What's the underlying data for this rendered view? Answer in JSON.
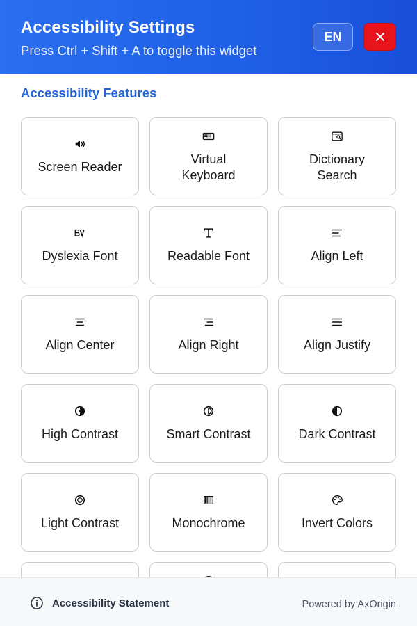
{
  "header": {
    "title": "Accessibility Settings",
    "subtitle": "Press Ctrl + Shift + A to toggle this widget",
    "language_label": "EN",
    "close_icon": "close-icon",
    "gradient_start": "#2a6fef",
    "gradient_end": "#1a4fd8",
    "close_color": "#e8141c"
  },
  "section": {
    "title": "Accessibility Features",
    "title_color": "#2566d6"
  },
  "features": [
    {
      "label": "Screen Reader",
      "icon": "speaker-icon"
    },
    {
      "label": "Virtual Keyboard",
      "icon": "keyboard-icon"
    },
    {
      "label": "Dictionary Search",
      "icon": "dictionary-icon"
    },
    {
      "label": "Dyslexia Font",
      "icon": "dyslexia-font-icon"
    },
    {
      "label": "Readable Font",
      "icon": "readable-font-icon"
    },
    {
      "label": "Align Left",
      "icon": "align-left-icon"
    },
    {
      "label": "Align Center",
      "icon": "align-center-icon"
    },
    {
      "label": "Align Right",
      "icon": "align-right-icon"
    },
    {
      "label": "Align Justify",
      "icon": "align-justify-icon"
    },
    {
      "label": "High Contrast",
      "icon": "high-contrast-icon"
    },
    {
      "label": "Smart Contrast",
      "icon": "smart-contrast-icon"
    },
    {
      "label": "Dark Contrast",
      "icon": "dark-contrast-icon"
    },
    {
      "label": "Light Contrast",
      "icon": "light-contrast-icon"
    },
    {
      "label": "Monochrome",
      "icon": "monochrome-icon"
    },
    {
      "label": "Invert Colors",
      "icon": "palette-icon"
    },
    {
      "label": "",
      "icon": ""
    },
    {
      "label": "",
      "icon": "palette-icon"
    },
    {
      "label": "",
      "icon": ""
    }
  ],
  "footer": {
    "statement_label": "Accessibility Statement",
    "statement_icon": "info-icon",
    "powered_by": "Powered by AxOrigin"
  }
}
